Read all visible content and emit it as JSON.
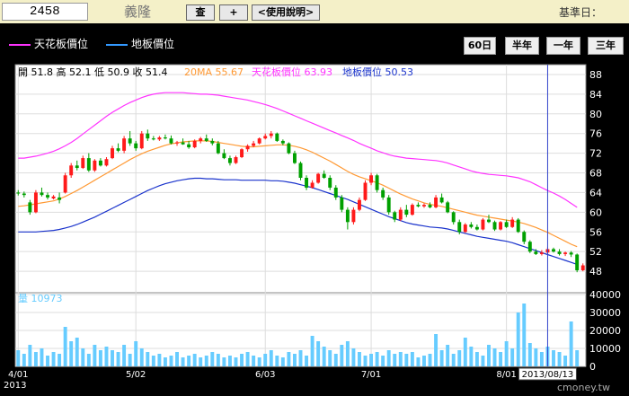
{
  "header": {
    "stock_code": "2458",
    "stock_name": "義隆",
    "query_button": "查",
    "add_button": "+",
    "help_button": "<使用說明>",
    "base_date_label": "基準日："
  },
  "legend": {
    "ceiling_label": "天花板價位",
    "floor_label": "地板價位",
    "ceiling_color": "#ff33ff",
    "floor_color": "#3399ff"
  },
  "range_buttons": [
    "60日",
    "半年",
    "一年",
    "三年"
  ],
  "watermark": "cmoney.tw",
  "colors": {
    "up": "#ff1a1a",
    "down": "#00a000",
    "ma20": "#ff9933",
    "ceiling": "#ff33ff",
    "floor": "#1a33cc",
    "volume": "#66ccff",
    "cursor": "#3344cc"
  },
  "chart_data": {
    "type": "candlestick",
    "price_info": "開 51.8  高 52.1  低 50.9  收 51.4",
    "ma20_text": "20MA 55.67",
    "ceiling_text": "天花板價位 63.93",
    "floor_text": "地板價位 50.53",
    "volume_text": "量 10973",
    "cursor_date": "2013/08/13",
    "price_ticks": [
      48,
      52,
      56,
      60,
      64,
      68,
      72,
      76,
      80,
      84,
      88
    ],
    "ylim": [
      44,
      90
    ],
    "volume_ticks": [
      "0",
      "10000",
      "20000",
      "30000",
      "40000"
    ],
    "volume_ylim": [
      0,
      40000
    ],
    "x_labels": [
      {
        "i": 0,
        "text": "4/01"
      },
      {
        "i": 20,
        "text": "5/02"
      },
      {
        "i": 42,
        "text": "6/03"
      },
      {
        "i": 60,
        "text": "7/01"
      },
      {
        "i": 83,
        "text": "8/01"
      }
    ],
    "year_label": "2013",
    "cursor_index": 90,
    "candles": [
      [
        64.0,
        64.5,
        63.4,
        63.8
      ],
      [
        63.8,
        64.2,
        63.0,
        63.5
      ],
      [
        62.0,
        62.5,
        59.5,
        60.0
      ],
      [
        60.0,
        64.5,
        59.8,
        64.0
      ],
      [
        64.0,
        65.0,
        63.2,
        63.5
      ],
      [
        63.5,
        64.0,
        62.6,
        63.0
      ],
      [
        62.8,
        63.5,
        62.6,
        63.2
      ],
      [
        63.0,
        64.0,
        61.8,
        62.5
      ],
      [
        64.0,
        68.0,
        63.8,
        67.5
      ],
      [
        67.5,
        70.0,
        67.0,
        69.5
      ],
      [
        69.5,
        70.5,
        68.5,
        69.0
      ],
      [
        69.0,
        71.5,
        68.8,
        71.0
      ],
      [
        71.0,
        72.0,
        68.2,
        68.5
      ],
      [
        68.5,
        70.8,
        68.2,
        70.5
      ],
      [
        70.5,
        71.0,
        69.3,
        69.5
      ],
      [
        69.5,
        71.2,
        69.3,
        70.8
      ],
      [
        71.0,
        73.5,
        70.8,
        73.0
      ],
      [
        73.0,
        74.0,
        72.2,
        72.5
      ],
      [
        72.5,
        75.5,
        72.0,
        75.0
      ],
      [
        75.0,
        76.5,
        73.5,
        74.0
      ],
      [
        74.0,
        74.5,
        72.5,
        73.0
      ],
      [
        73.0,
        76.5,
        72.8,
        76.0
      ],
      [
        76.0,
        76.8,
        74.5,
        75.0
      ],
      [
        75.0,
        75.5,
        74.6,
        74.8
      ],
      [
        74.8,
        75.5,
        74.5,
        75.2
      ],
      [
        75.2,
        75.8,
        74.8,
        75.0
      ],
      [
        75.0,
        75.6,
        73.8,
        74.0
      ],
      [
        74.0,
        74.5,
        73.5,
        74.2
      ],
      [
        74.2,
        75.0,
        73.7,
        73.8
      ],
      [
        73.8,
        74.5,
        72.9,
        73.2
      ],
      [
        73.2,
        74.8,
        73.0,
        74.5
      ],
      [
        74.5,
        75.3,
        74.0,
        75.0
      ],
      [
        75.0,
        75.8,
        74.3,
        74.5
      ],
      [
        74.5,
        75.0,
        73.6,
        74.0
      ],
      [
        74.0,
        74.5,
        71.8,
        72.0
      ],
      [
        72.0,
        72.8,
        70.8,
        71.0
      ],
      [
        71.0,
        71.5,
        69.5,
        70.0
      ],
      [
        70.0,
        71.5,
        69.8,
        71.2
      ],
      [
        71.2,
        73.0,
        71.0,
        72.8
      ],
      [
        72.8,
        73.8,
        72.3,
        73.5
      ],
      [
        73.5,
        74.5,
        73.2,
        74.0
      ],
      [
        74.0,
        75.2,
        73.8,
        75.0
      ],
      [
        75.0,
        76.0,
        74.8,
        75.5
      ],
      [
        75.5,
        76.5,
        75.0,
        76.0
      ],
      [
        76.0,
        76.2,
        74.3,
        74.5
      ],
      [
        74.5,
        74.8,
        73.6,
        74.0
      ],
      [
        74.0,
        74.2,
        71.8,
        72.0
      ],
      [
        72.0,
        72.5,
        69.8,
        70.0
      ],
      [
        70.0,
        70.3,
        66.5,
        67.0
      ],
      [
        67.0,
        67.5,
        64.5,
        65.0
      ],
      [
        65.0,
        66.5,
        64.8,
        66.0
      ],
      [
        66.0,
        68.0,
        65.8,
        67.8
      ],
      [
        67.8,
        68.5,
        66.8,
        67.0
      ],
      [
        67.0,
        67.5,
        64.5,
        65.0
      ],
      [
        65.0,
        65.5,
        62.5,
        63.0
      ],
      [
        63.0,
        63.5,
        60.0,
        60.5
      ],
      [
        60.5,
        61.0,
        56.5,
        58.0
      ],
      [
        58.0,
        61.0,
        57.5,
        60.5
      ],
      [
        60.5,
        63.0,
        60.2,
        62.5
      ],
      [
        62.5,
        66.5,
        62.3,
        66.0
      ],
      [
        66.0,
        68.0,
        65.5,
        67.5
      ],
      [
        67.5,
        67.8,
        64.0,
        64.5
      ],
      [
        64.5,
        65.0,
        62.5,
        63.0
      ],
      [
        63.0,
        63.5,
        59.5,
        60.0
      ],
      [
        60.0,
        60.3,
        58.0,
        58.5
      ],
      [
        58.5,
        61.0,
        58.2,
        60.5
      ],
      [
        60.5,
        61.5,
        59.0,
        59.5
      ],
      [
        59.5,
        61.8,
        59.3,
        61.5
      ],
      [
        61.5,
        62.0,
        61.0,
        61.2
      ],
      [
        61.2,
        61.8,
        60.9,
        61.5
      ],
      [
        61.5,
        62.0,
        60.8,
        61.0
      ],
      [
        61.0,
        63.5,
        60.8,
        63.0
      ],
      [
        63.0,
        63.8,
        61.8,
        62.0
      ],
      [
        62.0,
        62.3,
        59.8,
        60.0
      ],
      [
        60.0,
        60.2,
        57.5,
        58.0
      ],
      [
        58.0,
        58.5,
        55.5,
        56.0
      ],
      [
        56.0,
        57.8,
        55.8,
        57.5
      ],
      [
        57.5,
        58.0,
        56.7,
        57.0
      ],
      [
        57.0,
        57.5,
        56.3,
        56.5
      ],
      [
        56.5,
        58.8,
        56.3,
        58.5
      ],
      [
        58.5,
        59.5,
        57.8,
        58.0
      ],
      [
        58.0,
        58.3,
        56.2,
        56.5
      ],
      [
        56.5,
        58.2,
        56.3,
        58.0
      ],
      [
        58.0,
        58.5,
        56.8,
        57.0
      ],
      [
        57.0,
        59.0,
        56.8,
        58.5
      ],
      [
        58.5,
        58.8,
        55.8,
        56.0
      ],
      [
        56.0,
        56.3,
        53.5,
        54.0
      ],
      [
        54.0,
        54.3,
        51.7,
        52.0
      ],
      [
        52.0,
        52.5,
        51.3,
        51.5
      ],
      [
        51.5,
        52.3,
        51.2,
        51.8
      ],
      [
        51.8,
        53.0,
        51.5,
        52.5
      ],
      [
        52.5,
        52.8,
        51.8,
        52.0
      ],
      [
        52.0,
        52.5,
        51.2,
        51.5
      ],
      [
        51.5,
        52.0,
        51.1,
        51.8
      ],
      [
        51.8,
        52.1,
        50.9,
        51.4
      ],
      [
        51.4,
        51.6,
        47.8,
        48.2
      ],
      [
        48.2,
        49.6,
        48.0,
        49.2
      ]
    ],
    "ma20": [
      61.2,
      61.3,
      61.5,
      61.7,
      61.9,
      62.1,
      62.3,
      62.7,
      63.2,
      63.8,
      64.4,
      65.1,
      65.8,
      66.5,
      67.2,
      67.9,
      68.6,
      69.3,
      70.0,
      70.7,
      71.3,
      71.9,
      72.4,
      72.8,
      73.2,
      73.6,
      73.9,
      74.1,
      74.3,
      74.4,
      74.5,
      74.5,
      74.5,
      74.4,
      74.2,
      74.0,
      73.8,
      73.6,
      73.4,
      73.3,
      73.3,
      73.4,
      73.5,
      73.6,
      73.7,
      73.7,
      73.6,
      73.4,
      73.1,
      72.7,
      72.2,
      71.6,
      71.0,
      70.4,
      69.7,
      69.0,
      68.3,
      67.7,
      67.2,
      66.8,
      66.4,
      66.0,
      65.5,
      64.9,
      64.3,
      63.7,
      63.2,
      62.7,
      62.3,
      61.9,
      61.6,
      61.4,
      61.2,
      60.9,
      60.6,
      60.3,
      60.0,
      59.7,
      59.4,
      59.2,
      59.0,
      58.8,
      58.6,
      58.4,
      58.2,
      58.0,
      57.7,
      57.3,
      56.9,
      56.4,
      55.9,
      55.3,
      54.7,
      54.1,
      53.5,
      53.0
    ],
    "ceiling": [
      71.0,
      71.0,
      71.2,
      71.4,
      71.7,
      72.0,
      72.4,
      72.9,
      73.5,
      74.2,
      75.0,
      75.9,
      76.8,
      77.7,
      78.6,
      79.5,
      80.3,
      81.0,
      81.7,
      82.3,
      82.8,
      83.3,
      83.7,
      84.0,
      84.2,
      84.3,
      84.3,
      84.3,
      84.3,
      84.2,
      84.1,
      84.0,
      84.0,
      83.9,
      83.8,
      83.6,
      83.4,
      83.2,
      83.0,
      82.8,
      82.5,
      82.2,
      81.9,
      81.5,
      81.1,
      80.6,
      80.1,
      79.6,
      79.1,
      78.6,
      78.1,
      77.6,
      77.1,
      76.6,
      76.1,
      75.6,
      75.1,
      74.6,
      74.0,
      73.5,
      73.0,
      72.5,
      72.1,
      71.7,
      71.4,
      71.2,
      71.0,
      70.9,
      70.8,
      70.7,
      70.6,
      70.5,
      70.3,
      70.0,
      69.6,
      69.2,
      68.8,
      68.4,
      68.1,
      67.9,
      67.7,
      67.6,
      67.5,
      67.4,
      67.2,
      67.0,
      66.6,
      66.2,
      65.6,
      65.0,
      64.4,
      63.9,
      63.3,
      62.6,
      61.8,
      61.0
    ],
    "floor": [
      56.0,
      56.0,
      56.0,
      56.0,
      56.1,
      56.2,
      56.3,
      56.5,
      56.8,
      57.1,
      57.5,
      58.0,
      58.5,
      59.0,
      59.6,
      60.2,
      60.8,
      61.4,
      62.0,
      62.6,
      63.2,
      63.8,
      64.4,
      64.9,
      65.4,
      65.8,
      66.1,
      66.4,
      66.6,
      66.8,
      66.9,
      66.9,
      66.8,
      66.8,
      66.7,
      66.6,
      66.6,
      66.6,
      66.5,
      66.5,
      66.5,
      66.5,
      66.5,
      66.4,
      66.4,
      66.3,
      66.1,
      65.9,
      65.6,
      65.3,
      65.0,
      64.6,
      64.2,
      63.8,
      63.4,
      63.0,
      62.6,
      62.1,
      61.6,
      61.1,
      60.6,
      60.1,
      59.6,
      59.1,
      58.7,
      58.3,
      57.9,
      57.6,
      57.4,
      57.2,
      57.0,
      56.9,
      56.8,
      56.6,
      56.3,
      56.0,
      55.7,
      55.4,
      55.1,
      54.9,
      54.7,
      54.5,
      54.3,
      54.1,
      53.8,
      53.4,
      53.0,
      52.6,
      52.2,
      51.8,
      51.4,
      51.0,
      50.6,
      50.2,
      49.8,
      49.4
    ],
    "volume": [
      9000,
      7000,
      12000,
      8000,
      10000,
      6000,
      8000,
      7000,
      22000,
      14000,
      16000,
      10000,
      7000,
      12000,
      9000,
      11000,
      9000,
      8000,
      12000,
      7000,
      14000,
      10000,
      8000,
      6000,
      7000,
      5000,
      6000,
      8000,
      5000,
      6000,
      7000,
      5000,
      6000,
      8000,
      7000,
      5000,
      6000,
      5000,
      7000,
      8000,
      6000,
      5000,
      7000,
      9000,
      6000,
      5000,
      8000,
      7000,
      9000,
      6000,
      17000,
      14000,
      11000,
      9000,
      7000,
      12000,
      14000,
      10000,
      8000,
      6000,
      7000,
      8000,
      6000,
      9000,
      7000,
      8000,
      7000,
      8000,
      5000,
      6000,
      7000,
      18000,
      9000,
      12000,
      7000,
      9000,
      16000,
      11000,
      8000,
      6000,
      12000,
      10000,
      8000,
      14000,
      10000,
      30000,
      35000,
      13000,
      10000,
      8000,
      11000,
      9000,
      8000,
      6000,
      25000,
      9000
    ]
  }
}
